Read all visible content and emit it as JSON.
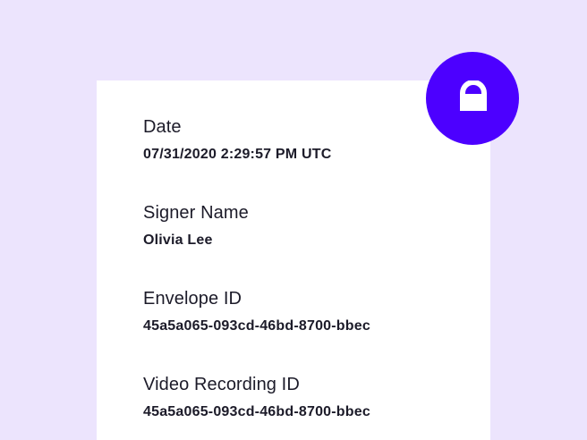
{
  "colors": {
    "background": "#ECE4FD",
    "card": "#FFFFFF",
    "accent": "#4C00FF",
    "text": "#1C1B29"
  },
  "badge": {
    "icon": "lock-icon"
  },
  "details": [
    {
      "label": "Date",
      "value": "07/31/2020 2:29:57 PM UTC"
    },
    {
      "label": "Signer Name",
      "value": "Olivia Lee"
    },
    {
      "label": "Envelope ID",
      "value": "45a5a065-093cd-46bd-8700-bbec"
    },
    {
      "label": "Video Recording ID",
      "value": "45a5a065-093cd-46bd-8700-bbec"
    }
  ]
}
